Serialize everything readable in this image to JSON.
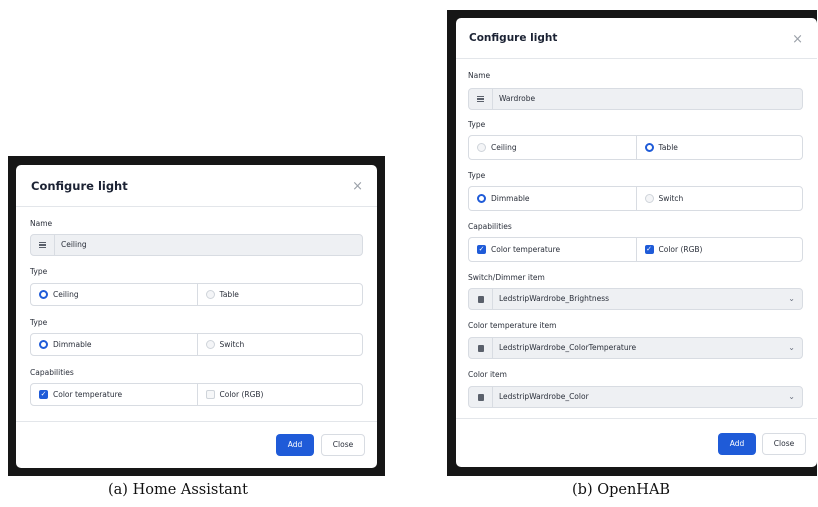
{
  "ha": {
    "title": "Configure light",
    "name_label": "Name",
    "name_value": "Ceiling",
    "type1_label": "Type",
    "type1_options": [
      "Ceiling",
      "Table"
    ],
    "type2_label": "Type",
    "type2_options": [
      "Dimmable",
      "Switch"
    ],
    "cap_label": "Capabilities",
    "cap_options": [
      "Color temperature",
      "Color (RGB)"
    ],
    "add_label": "Add",
    "close_label": "Close",
    "caption": "(a) Home Assistant"
  },
  "oh": {
    "title": "Configure light",
    "name_label": "Name",
    "name_value": "Wardrobe",
    "type1_label": "Type",
    "type1_options": [
      "Ceiling",
      "Table"
    ],
    "type2_label": "Type",
    "type2_options": [
      "Dimmable",
      "Switch"
    ],
    "cap_label": "Capabilities",
    "cap_options": [
      "Color temperature",
      "Color (RGB)"
    ],
    "switch_label": "Switch/Dimmer item",
    "switch_value": "LedstripWardrobe_Brightness",
    "ct_label": "Color temperature item",
    "ct_value": "LedstripWardrobe_ColorTemperature",
    "color_label": "Color item",
    "color_value": "LedstripWardrobe_Color",
    "add_label": "Add",
    "close_label": "Close",
    "caption": "(b) OpenHAB"
  },
  "icons": {
    "close": "close-icon",
    "list": "list-icon",
    "file": "file-icon",
    "chevron": "chevron-down-icon",
    "check": "check-icon"
  },
  "colors": {
    "accent": "#1f5bd8",
    "backdrop": "#161616"
  }
}
